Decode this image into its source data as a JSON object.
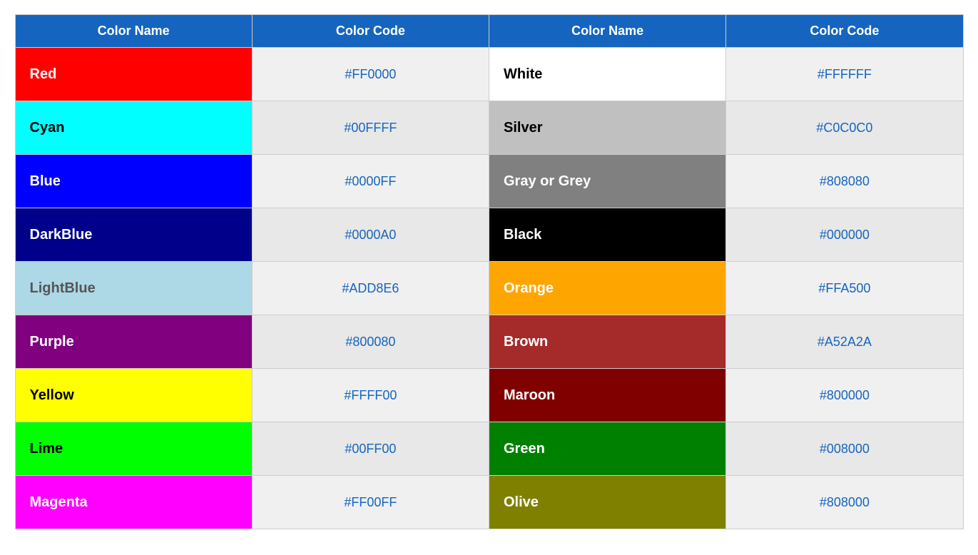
{
  "table": {
    "headers": [
      "Color Name",
      "Color Code",
      "Color Name",
      "Color Code"
    ],
    "rows": [
      {
        "left_name": "Red",
        "left_bg": "#FF0000",
        "left_text": "#ffffff",
        "left_code": "#FF0000",
        "right_name": "White",
        "right_bg": "#FFFFFF",
        "right_text": "#000000",
        "right_code": "#FFFFFF"
      },
      {
        "left_name": "Cyan",
        "left_bg": "#00FFFF",
        "left_text": "#000000",
        "left_code": "#00FFFF",
        "right_name": "Silver",
        "right_bg": "#C0C0C0",
        "right_text": "#000000",
        "right_code": "#C0C0C0"
      },
      {
        "left_name": "Blue",
        "left_bg": "#0000FF",
        "left_text": "#ffffff",
        "left_code": "#0000FF",
        "right_name": "Gray or Grey",
        "right_bg": "#808080",
        "right_text": "#ffffff",
        "right_code": "#808080"
      },
      {
        "left_name": "DarkBlue",
        "left_bg": "#00008B",
        "left_text": "#ffffff",
        "left_code": "#0000A0",
        "right_name": "Black",
        "right_bg": "#000000",
        "right_text": "#ffffff",
        "right_code": "#000000"
      },
      {
        "left_name": "LightBlue",
        "left_bg": "#ADD8E6",
        "left_text": "#555555",
        "left_code": "#ADD8E6",
        "right_name": "Orange",
        "right_bg": "#FFA500",
        "right_text": "#ffffff",
        "right_code": "#FFA500"
      },
      {
        "left_name": "Purple",
        "left_bg": "#800080",
        "left_text": "#ffffff",
        "left_code": "#800080",
        "right_name": "Brown",
        "right_bg": "#A52A2A",
        "right_text": "#ffffff",
        "right_code": "#A52A2A"
      },
      {
        "left_name": "Yellow",
        "left_bg": "#FFFF00",
        "left_text": "#000000",
        "left_code": "#FFFF00",
        "right_name": "Maroon",
        "right_bg": "#800000",
        "right_text": "#ffffff",
        "right_code": "#800000"
      },
      {
        "left_name": "Lime",
        "left_bg": "#00FF00",
        "left_text": "#000000",
        "left_code": "#00FF00",
        "right_name": "Green",
        "right_bg": "#008000",
        "right_text": "#ffffff",
        "right_code": "#008000"
      },
      {
        "left_name": "Magenta",
        "left_bg": "#FF00FF",
        "left_text": "#ffffff",
        "left_code": "#FF00FF",
        "right_name": "Olive",
        "right_bg": "#808000",
        "right_text": "#ffffff",
        "right_code": "#808000"
      }
    ]
  }
}
